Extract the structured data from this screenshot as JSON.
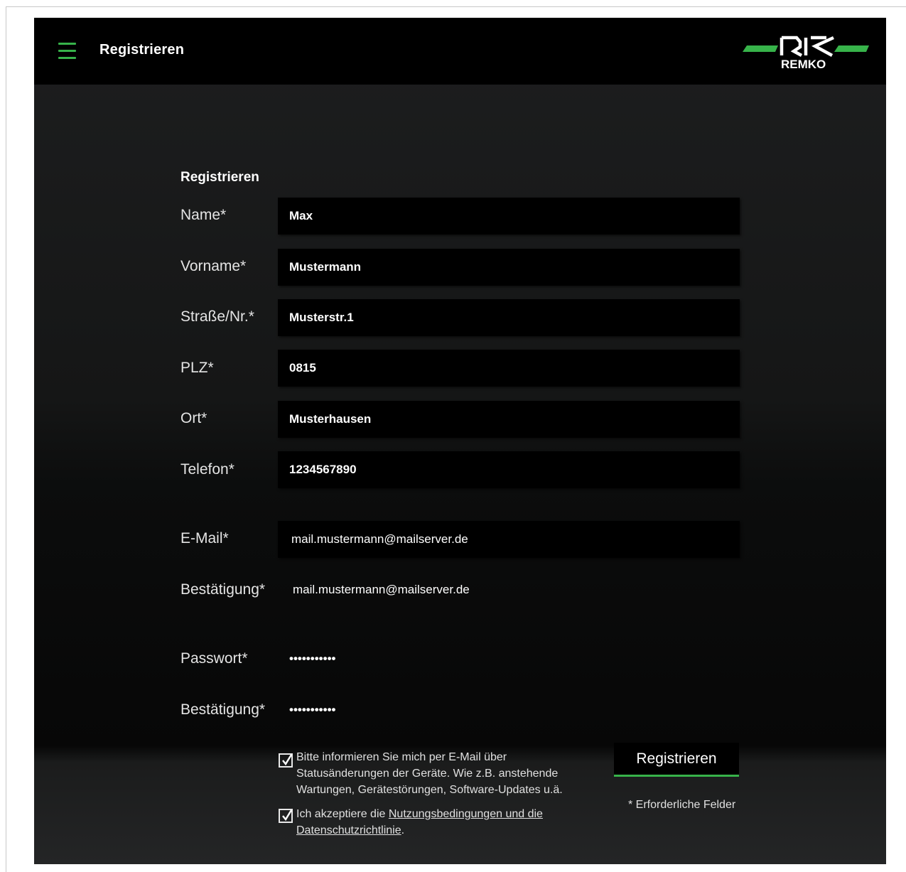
{
  "header": {
    "title": "Registrieren",
    "menu_icon": "hamburger-menu-icon",
    "brand": "REMKO",
    "accent_color": "#37b34a"
  },
  "form": {
    "title": "Registrieren",
    "fields": [
      {
        "label": "Name*",
        "value": "Max"
      },
      {
        "label": "Vorname*",
        "value": "Mustermann"
      },
      {
        "label": "Straße/Nr.*",
        "value": "Musterstr.1"
      },
      {
        "label": "PLZ*",
        "value": "0815"
      },
      {
        "label": "Ort*",
        "value": "Musterhausen"
      },
      {
        "label": "Telefon*",
        "value": "1234567890"
      },
      {
        "label": "E-Mail*",
        "value": "mail.mustermann@mailserver.de"
      },
      {
        "label": "Bestätigung*",
        "value": "mail.mustermann@mailserver.de"
      },
      {
        "label": "Passwort*",
        "value": "•••••••••••"
      },
      {
        "label": "Bestätigung*",
        "value": "•••••••••••"
      }
    ],
    "notify_checkbox": {
      "checked": true,
      "line1": "Bitte informieren Sie mich per E-Mail über",
      "line2": "Statusänderungen der Geräte. Wie z.B. anstehende",
      "line3": "Wartungen, Gerätestörungen, Software-Updates u.ä."
    },
    "terms_checkbox": {
      "checked": true,
      "prefix": "Ich akzeptiere die ",
      "link_line1": "Nutzungsbedingungen und die",
      "link_line2": "Datenschutzrichtlinie",
      "suffix": "."
    },
    "submit_label": "Registrieren",
    "required_note": "* Erforderliche Felder"
  }
}
